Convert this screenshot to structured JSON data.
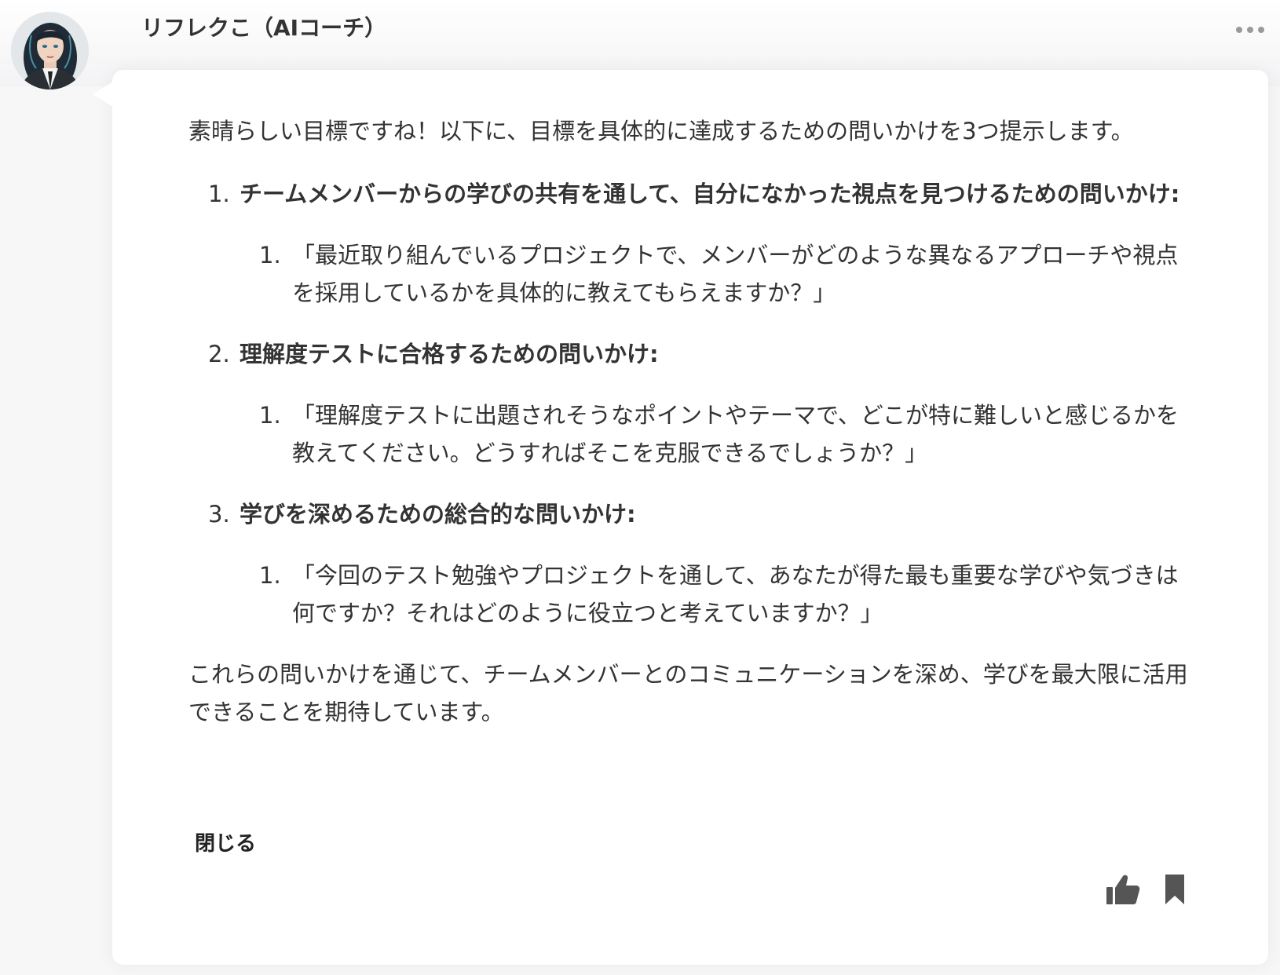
{
  "header": {
    "name": "リフレクこ（AIコーチ）",
    "avatar_icon": "coach-avatar"
  },
  "message": {
    "intro": "素晴らしい目標ですね！以下に、目標を具体的に達成するための問いかけを3つ提示します。",
    "sections": [
      {
        "num": "1.",
        "title": "チームメンバーからの学びの共有を通して、自分になかった視点を見つけるための問いかけ:",
        "sub": {
          "num": "1.",
          "text": "「最近取り組んでいるプロジェクトで、メンバーがどのような異なるアプローチや視点を採用しているかを具体的に教えてもらえますか？」"
        }
      },
      {
        "num": "2.",
        "title": "理解度テストに合格するための問いかけ:",
        "sub": {
          "num": "1.",
          "text": "「理解度テストに出題されそうなポイントやテーマで、どこが特に難しいと感じるかを教えてください。どうすればそこを克服できるでしょうか？」"
        }
      },
      {
        "num": "3.",
        "title": "学びを深めるための総合的な問いかけ:",
        "sub": {
          "num": "1.",
          "text": "「今回のテスト勉強やプロジェクトを通して、あなたが得た最も重要な学びや気づきは何ですか？それはどのように役立つと考えていますか？」"
        }
      }
    ],
    "outro": "これらの問いかけを通じて、チームメンバーとのコミュニケーションを深め、学びを最大限に活用できることを期待しています。",
    "close_label": "閉じる"
  },
  "actions": {
    "like_icon": "thumbs-up-icon",
    "bookmark_icon": "bookmark-icon",
    "more_icon": "more-horizontal-icon"
  },
  "colors": {
    "text": "#333333",
    "icon": "#555555",
    "background": "#f7f7f8",
    "bubble": "#ffffff"
  }
}
